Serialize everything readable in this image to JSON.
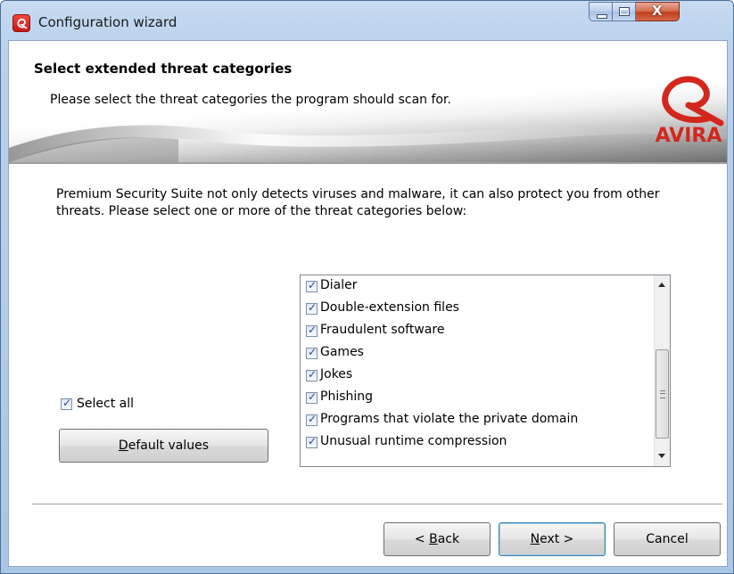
{
  "window": {
    "title": "Configuration wizard",
    "icons": {
      "app": "avira-umbrella-icon",
      "minimize": "minimize-icon",
      "maximize": "maximize-icon",
      "close": "close-icon"
    }
  },
  "header": {
    "title": "Select extended threat categories",
    "subtitle": "Please select the threat categories the program should scan for.",
    "logo_text": "AVIRA"
  },
  "description": "Premium Security Suite not only detects viruses and malware,  it can also protect you from other threats. Please select one or more of the threat categories below:",
  "select_all": {
    "label": "Select all",
    "checked": true
  },
  "default_values_button": {
    "pre": "",
    "mnemonic": "D",
    "post": "efault values"
  },
  "threat_list": {
    "items": [
      {
        "label": "Dialer",
        "checked": true
      },
      {
        "label": "Double-extension files",
        "checked": true
      },
      {
        "label": "Fraudulent software",
        "checked": true
      },
      {
        "label": "Games",
        "checked": true
      },
      {
        "label": "Jokes",
        "checked": true
      },
      {
        "label": "Phishing",
        "checked": true
      },
      {
        "label": "Programs that violate the private domain",
        "checked": true
      },
      {
        "label": "Unusual runtime compression",
        "checked": true
      }
    ]
  },
  "buttons": {
    "back": {
      "pre": "< ",
      "mnemonic": "B",
      "post": "ack"
    },
    "next": {
      "pre": "",
      "mnemonic": "N",
      "post": "ext >"
    },
    "cancel": "Cancel"
  },
  "colors": {
    "brand_red": "#d3271d",
    "titlebar": "#b9d1ec",
    "close_button": "#c23e1d"
  }
}
